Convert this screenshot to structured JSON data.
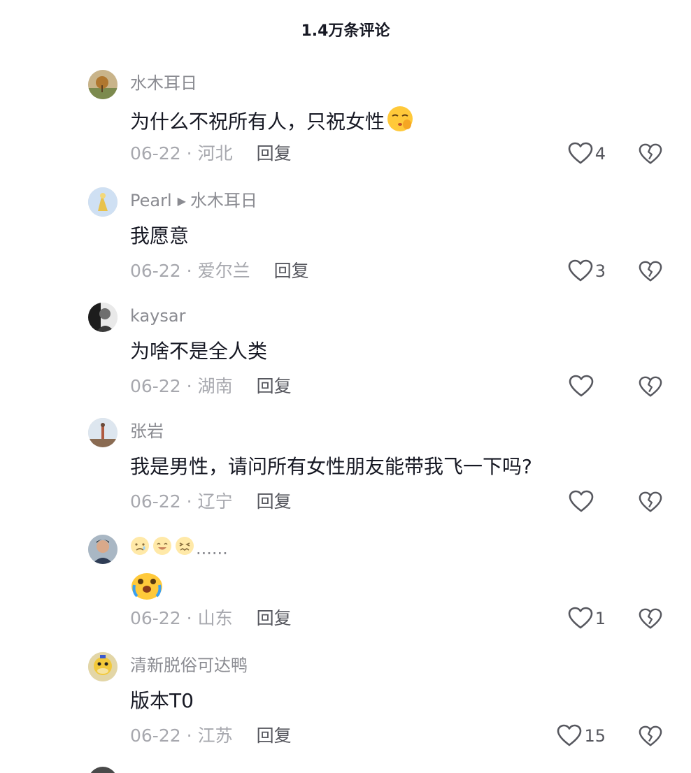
{
  "header": {
    "title": "1.4万条评论"
  },
  "comments": [
    {
      "author": "水木耳日",
      "reply_to": "",
      "text": "为什么不祝所有人，只祝女性",
      "date": "06-22",
      "location": "河北",
      "reply_label": "回复",
      "likes": "4",
      "text_emoji": "shushing-face-emoji"
    },
    {
      "author": "Pearl",
      "reply_to": "水木耳日",
      "text": "我愿意",
      "date": "06-22",
      "location": "爱尔兰",
      "reply_label": "回复",
      "likes": "3"
    },
    {
      "author": "kaysar",
      "reply_to": "",
      "text": "为啥不是全人类",
      "date": "06-22",
      "location": "湖南",
      "reply_label": "回复",
      "likes": ""
    },
    {
      "author": "张岩",
      "reply_to": "",
      "text": "我是男性，请问所有女性朋友能带我飞一下吗?",
      "date": "06-22",
      "location": "辽宁",
      "reply_label": "回复",
      "likes": ""
    },
    {
      "author": "......",
      "author_emojis": [
        "crying-face-emoji",
        "grinning-face-emoji",
        "tired-face-emoji"
      ],
      "reply_to": "",
      "text": "",
      "text_emoji": "loudly-crying-face-emoji",
      "date": "06-22",
      "location": "山东",
      "reply_label": "回复",
      "likes": "1"
    },
    {
      "author": "清新脱俗可达鸭",
      "reply_to": "",
      "text": "版本T0",
      "date": "06-22",
      "location": "江苏",
      "reply_label": "回复",
      "likes": "15"
    }
  ],
  "icons": {
    "like": "heart-outline-icon",
    "dislike": "broken-heart-icon",
    "reply_arrow": "triangle-right-icon"
  },
  "colors": {
    "primary_text": "#161823",
    "secondary_text": "#8a8b91",
    "meta_text": "#a7a8ae",
    "icon": "#56575e",
    "emoji_yellow": "#ffc93a"
  }
}
